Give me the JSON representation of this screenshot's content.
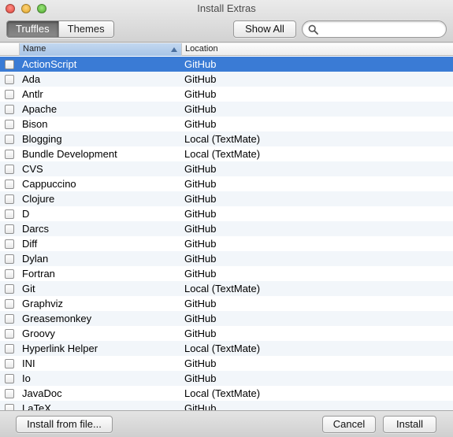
{
  "window": {
    "title": "Install Extras"
  },
  "toolbar": {
    "tabs": [
      {
        "label": "Truffles",
        "active": true
      },
      {
        "label": "Themes",
        "active": false
      }
    ],
    "show_all_label": "Show All",
    "search": {
      "value": "",
      "placeholder": ""
    }
  },
  "table": {
    "columns": {
      "check": "",
      "name": "Name",
      "location": "Location"
    },
    "sort": {
      "column": "Name",
      "direction": "ascending"
    },
    "rows": [
      {
        "name": "ActionScript",
        "location": "GitHub",
        "checked": false,
        "selected": true
      },
      {
        "name": "Ada",
        "location": "GitHub",
        "checked": false
      },
      {
        "name": "Antlr",
        "location": "GitHub",
        "checked": false
      },
      {
        "name": "Apache",
        "location": "GitHub",
        "checked": false
      },
      {
        "name": "Bison",
        "location": "GitHub",
        "checked": false
      },
      {
        "name": "Blogging",
        "location": "Local (TextMate)",
        "checked": false
      },
      {
        "name": "Bundle Development",
        "location": "Local (TextMate)",
        "checked": false
      },
      {
        "name": "CVS",
        "location": "GitHub",
        "checked": false
      },
      {
        "name": "Cappuccino",
        "location": "GitHub",
        "checked": false
      },
      {
        "name": "Clojure",
        "location": "GitHub",
        "checked": false
      },
      {
        "name": "D",
        "location": "GitHub",
        "checked": false
      },
      {
        "name": "Darcs",
        "location": "GitHub",
        "checked": false
      },
      {
        "name": "Diff",
        "location": "GitHub",
        "checked": false
      },
      {
        "name": "Dylan",
        "location": "GitHub",
        "checked": false
      },
      {
        "name": "Fortran",
        "location": "GitHub",
        "checked": false
      },
      {
        "name": "Git",
        "location": "Local (TextMate)",
        "checked": false
      },
      {
        "name": "Graphviz",
        "location": "GitHub",
        "checked": false
      },
      {
        "name": "Greasemonkey",
        "location": "GitHub",
        "checked": false
      },
      {
        "name": "Groovy",
        "location": "GitHub",
        "checked": false
      },
      {
        "name": "Hyperlink Helper",
        "location": "Local (TextMate)",
        "checked": false
      },
      {
        "name": "INI",
        "location": "GitHub",
        "checked": false
      },
      {
        "name": "Io",
        "location": "GitHub",
        "checked": false
      },
      {
        "name": "JavaDoc",
        "location": "Local (TextMate)",
        "checked": false
      },
      {
        "name": "LaTeX",
        "location": "GitHub",
        "checked": false
      }
    ]
  },
  "footer": {
    "install_from_file_label": "Install from file...",
    "cancel_label": "Cancel",
    "install_label": "Install"
  },
  "colors": {
    "selection": "#3a7bd5",
    "stripe": "#f2f6fa"
  }
}
